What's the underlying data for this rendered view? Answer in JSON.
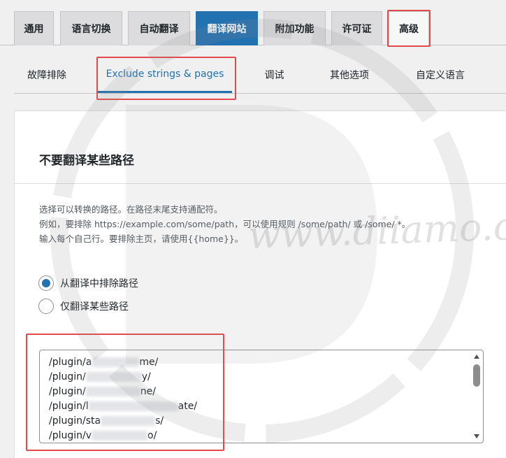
{
  "tabs": [
    {
      "label": "通用",
      "active": false
    },
    {
      "label": "语言切换",
      "active": false
    },
    {
      "label": "自动翻译",
      "active": false
    },
    {
      "label": "翻译网站",
      "active": true
    },
    {
      "label": "附加功能",
      "active": false
    },
    {
      "label": "许可证",
      "active": false
    },
    {
      "label": "高级",
      "active": false
    }
  ],
  "subtabs": [
    {
      "label": "故障排除",
      "active": false
    },
    {
      "label": "Exclude strings & pages",
      "active": true
    },
    {
      "label": "调试",
      "active": false
    },
    {
      "label": "其他选项",
      "active": false
    },
    {
      "label": "自定义语言",
      "active": false
    }
  ],
  "section": {
    "title": "不要翻译某些路径",
    "desc_lines": [
      "选择可以转换的路径。在路径末尾支持通配符。",
      "例如，要排除 https://example.com/some/path，可以使用规则 /some/path/ 或 /some/ *。",
      "输入每个自己行。要排除主页，请使用{{home}}。"
    ]
  },
  "radios": [
    {
      "label": "从翻译中排除路径",
      "checked": true
    },
    {
      "label": "仅翻译某些路径",
      "checked": false
    }
  ],
  "paths": [
    {
      "prefix": "/plugin/a",
      "suffix": "me/"
    },
    {
      "prefix": "/plugin/",
      "suffix": "y/"
    },
    {
      "prefix": "/plugin/",
      "suffix": "ne/"
    },
    {
      "prefix": "/plugin/l",
      "suffix": "ate/"
    },
    {
      "prefix": "/plugin/sta",
      "suffix": "s/"
    },
    {
      "prefix": "/plugin/v",
      "suffix": "o/"
    }
  ],
  "watermark": "www.diiamo.cn",
  "colors": {
    "accent": "#2271b1",
    "highlight": "#e34b4b"
  }
}
